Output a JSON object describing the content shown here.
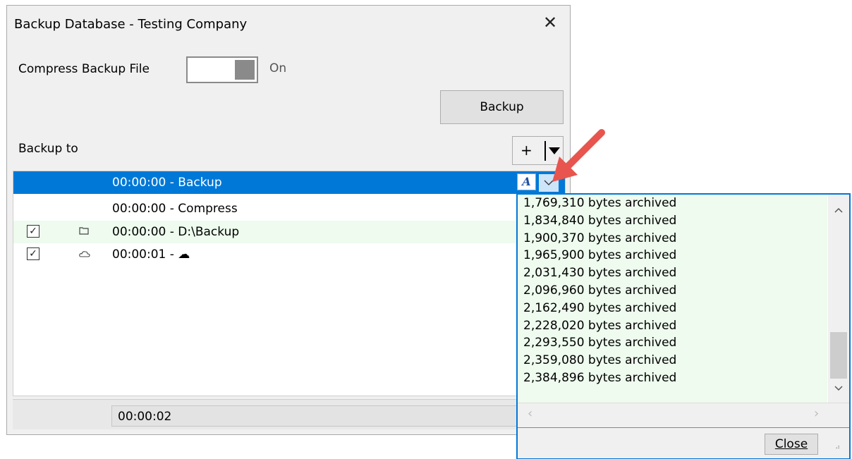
{
  "dialog": {
    "title": "Backup Database - Testing Company",
    "close_glyph": "✕",
    "compress_label": "Compress Backup File",
    "compress_state": "On",
    "compress_on": true,
    "backup_button": "Backup",
    "backup_to_label": "Backup to",
    "add_button_label": "+",
    "rows": [
      {
        "time": "00:00:00 - Backup",
        "checked": null,
        "icon": null,
        "selected": true
      },
      {
        "time": "00:00:00 - Compress",
        "checked": null,
        "icon": null
      },
      {
        "time": "00:00:00 - D:\\Backup",
        "checked": true,
        "icon": "folder-icon"
      },
      {
        "time": "00:00:01 - ☁",
        "checked": true,
        "icon": "cloud-icon"
      }
    ],
    "status_elapsed": "00:00:02"
  },
  "popup": {
    "log_lines": [
      "1,769,310 bytes archived",
      "1,834,840 bytes archived",
      "1,900,370 bytes archived",
      "1,965,900 bytes archived",
      "2,031,430 bytes archived",
      "2,096,960 bytes archived",
      "2,162,490 bytes archived",
      "2,228,020 bytes archived",
      "2,293,550 bytes archived",
      "2,359,080 bytes archived",
      "2,384,896 bytes archived"
    ],
    "close_button": "Close"
  },
  "colors": {
    "selection": "#0078d7",
    "row_highlight": "#eefbee",
    "arrow": "#e8554e"
  }
}
